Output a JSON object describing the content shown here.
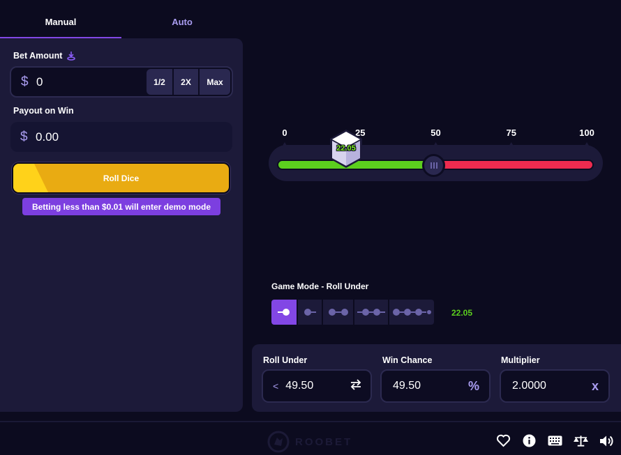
{
  "tabs": {
    "manual": "Manual",
    "auto": "Auto",
    "active": "manual"
  },
  "bet": {
    "label": "Bet Amount",
    "currency_symbol": "$",
    "value": "0",
    "half_label": "1/2",
    "double_label": "2X",
    "max_label": "Max"
  },
  "payout": {
    "label": "Payout on Win",
    "currency_symbol": "$",
    "value": "0.00"
  },
  "roll_button": {
    "label": "Roll Dice"
  },
  "demo_notice": "Betting less than $0.01 will enter demo mode",
  "slider": {
    "ticks": [
      "0",
      "25",
      "50",
      "75",
      "100"
    ],
    "roll_value": "22.05",
    "target": 49.5,
    "green_color": "#5ccf1e",
    "red_color": "#ee2b4f"
  },
  "game_mode": {
    "label": "Game Mode - Roll Under",
    "options": [
      "mode-1",
      "mode-2",
      "mode-3",
      "mode-4",
      "mode-5"
    ],
    "selected_index": 0,
    "result": "22.05"
  },
  "stats": {
    "roll_under": {
      "label": "Roll Under",
      "prefix": "<",
      "value": "49.50"
    },
    "win_chance": {
      "label": "Win Chance",
      "value": "49.50",
      "suffix": "%"
    },
    "multiplier": {
      "label": "Multiplier",
      "value": "2.0000",
      "suffix": "x"
    }
  },
  "footer": {
    "brand": "ROOBET",
    "icons": [
      "heart-icon",
      "info-icon",
      "keyboard-icon",
      "scales-icon",
      "speaker-icon"
    ]
  },
  "colors": {
    "accent": "#8247e5",
    "roll_button": "#e9ab12",
    "panel": "#1c1a39",
    "background": "#0c0b1f"
  }
}
